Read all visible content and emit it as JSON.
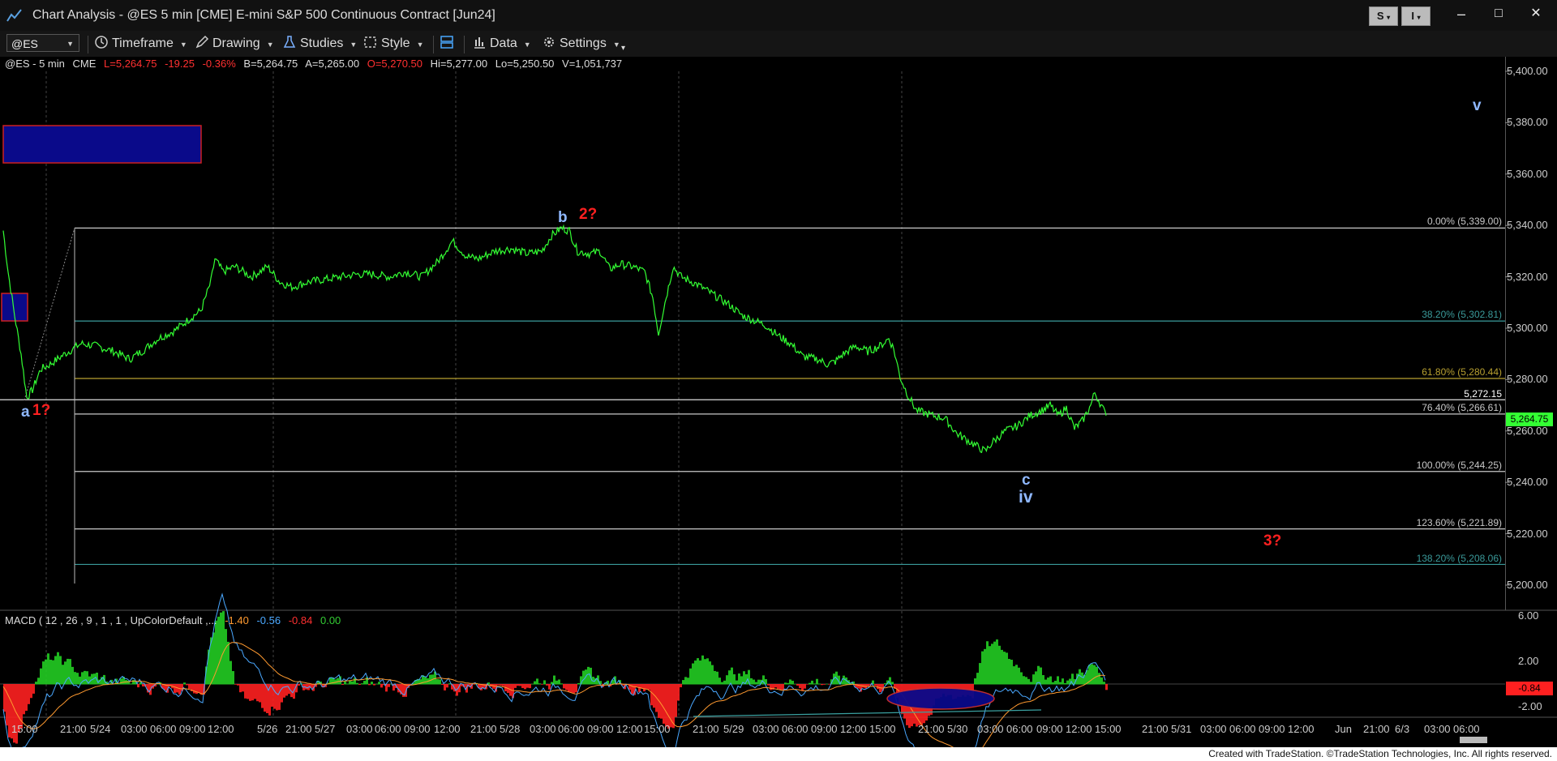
{
  "window": {
    "title": "Chart Analysis - @ES 5 min [CME] E-mini S&P 500 Continuous Contract [Jun24]",
    "btn_s": "S",
    "btn_i": "I",
    "min": "–",
    "max": "□",
    "close": "✕"
  },
  "toolbar": {
    "symbol": "@ES",
    "timeframe": "Timeframe",
    "drawing": "Drawing",
    "studies": "Studies",
    "style": "Style",
    "data": "Data",
    "settings": "Settings"
  },
  "legend": {
    "symbol": "@ES - 5 min",
    "exchange": "CME",
    "last": "L=5,264.75",
    "change": "-19.25",
    "pct": "-0.36%",
    "bid": "B=5,264.75",
    "ask": "A=5,265.00",
    "open": "O=5,270.50",
    "high": "Hi=5,277.00",
    "low": "Lo=5,250.50",
    "volume": "V=1,051,737"
  },
  "macd_legend": {
    "name": "MACD ( 12 , 26 , 9 , 1 , 1 , UpColorDefault ,...",
    "v1": "-1.40",
    "v2": "-0.56",
    "v3": "-0.84",
    "v4": "0.00"
  },
  "y_axis": [
    "5,400.00",
    "5,380.00",
    "5,360.00",
    "5,340.00",
    "5,320.00",
    "5,300.00",
    "5,280.00",
    "5,260.00",
    "5,240.00",
    "5,220.00",
    "5,200.00"
  ],
  "macd_axis": [
    "6.00",
    "2.00",
    "-2.00"
  ],
  "macd_tag": "-0.84",
  "price_tag": "5,264.75",
  "x_axis": [
    "15:00",
    "21:00",
    "5/24",
    "03:00",
    "06:00",
    "09:00",
    "12:00",
    "5/26",
    "21:00",
    "5/27",
    "03:00",
    "06:00",
    "09:00",
    "12:00",
    "21:00",
    "5/28",
    "03:00",
    "06:00",
    "09:00",
    "12:00",
    "15:00",
    "21:00",
    "5/29",
    "03:00",
    "06:00",
    "09:00",
    "12:00",
    "15:00",
    "21:00",
    "5/30",
    "03:00",
    "06:00",
    "09:00",
    "12:00",
    "15:00",
    "21:00",
    "5/31",
    "03:00",
    "06:00",
    "09:00",
    "12:00",
    "Jun",
    "21:00",
    "6/3",
    "03:00",
    "06:00"
  ],
  "fib": {
    "f0": "0.00% (5,339.00)",
    "f382": "38.20% (5,302.81)",
    "f618": "61.80% (5,280.44)",
    "hline": "5,272.15",
    "f764": "76.40% (5,266.61)",
    "f100": "100.00% (5,244.25)",
    "f1236": "123.60% (5,221.89)",
    "f1382": "138.20% (5,208.06)"
  },
  "waves": {
    "a": "a",
    "one": "1?",
    "b": "b",
    "two": "2?",
    "c": "c",
    "iv": "iv",
    "three": "3?",
    "v": "v"
  },
  "colors": {
    "price_line": "#33ff33",
    "wave_blue": "#8fb8ff",
    "wave_red": "#ff2020",
    "fib_teal": "#3a9a9a",
    "fib_gold": "#b8a030",
    "fib_gray": "#c8c8c8"
  },
  "footer": "Created with TradeStation. ©TradeStation Technologies, Inc. All rights reserved."
}
